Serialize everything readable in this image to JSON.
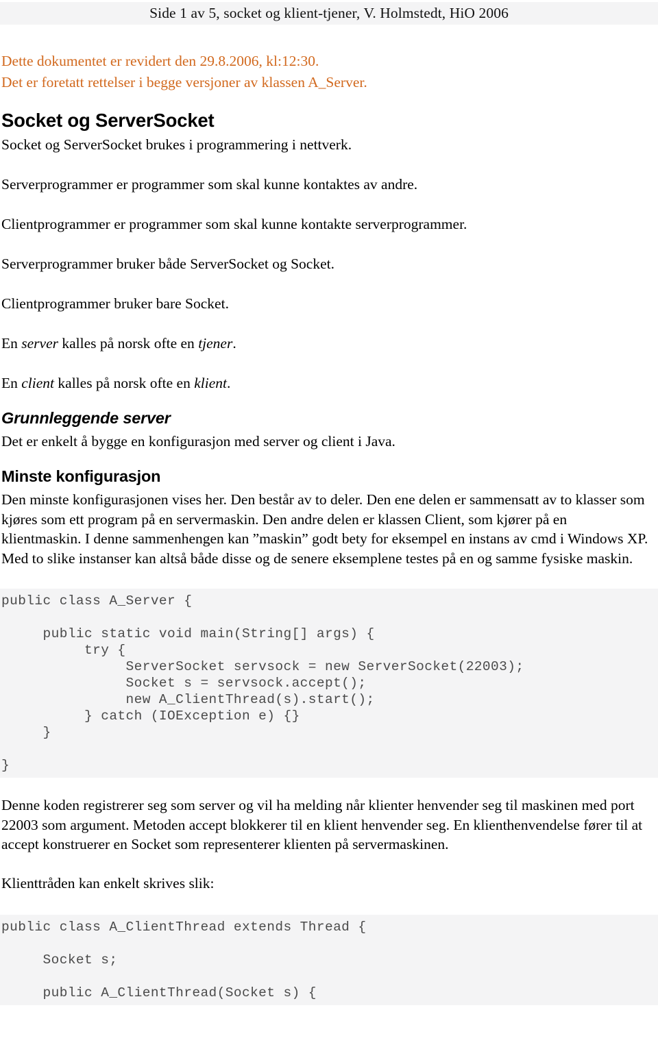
{
  "header": {
    "running_head": "Side 1 av 5, socket og klient-tjener, V. Holmstedt, HiO 2006"
  },
  "revision": {
    "line1": "Dette dokumentet er revidert den 29.8.2006, kl:12:30.",
    "line2": "Det er foretatt rettelser i begge versjoner av klassen A_Server.",
    "color": "#d2691e"
  },
  "sections": {
    "title": "Socket og ServerSocket",
    "intro_lines": [
      "Socket og ServerSocket brukes i programmering i nettverk.",
      "Serverprogrammer er programmer som skal kunne kontaktes av andre.",
      "Clientprogrammer er programmer som skal kunne kontakte serverprogrammer.",
      "Serverprogrammer bruker både ServerSocket og Socket.",
      "Clientprogrammer bruker bare Socket."
    ],
    "server_line_pre": "En ",
    "server_line_em1": "server",
    "server_line_mid": " kalles på norsk ofte en ",
    "server_line_em2": "tjener",
    "server_line_post": ".",
    "client_line_pre": "En ",
    "client_line_em1": "client",
    "client_line_mid": " kalles på norsk ofte en ",
    "client_line_em2": "klient",
    "client_line_post": ".",
    "heading_grunnleggende": "Grunnleggende server",
    "grunnleggende_body": "Det er enkelt å bygge en konfigurasjon med server og client i Java.",
    "heading_minste": "Minste konfigurasjon",
    "minste_body": "Den minste konfigurasjonen vises her. Den består av to deler. Den ene delen er sammensatt av to klasser som kjøres som ett program på en servermaskin. Den andre delen er klassen Client, som kjører på en klientmaskin. I denne sammenhengen kan ”maskin” godt bety for eksempel en instans av cmd i Windows XP. Med to slike instanser kan altså både disse og de senere eksemplene testes på en og samme fysiske maskin.",
    "after_code_body": "Denne koden registrerer seg som server og vil ha melding når klienter henvender seg til maskinen med port 22003 som argument. Metoden accept blokkerer til en klient henvender seg. En klienthenvendelse fører til at accept konstruerer en Socket som representerer klienten på servermaskinen.",
    "klienttraden_line": "Klienttråden kan enkelt skrives slik:"
  },
  "code": {
    "block1": "public class A_Server {\n\n     public static void main(String[] args) {\n          try {\n               ServerSocket servsock = new ServerSocket(22003);\n               Socket s = servsock.accept();\n               new A_ClientThread(s).start();\n          } catch (IOException e) {}\n     }\n\n}",
    "block2": "public class A_ClientThread extends Thread {\n\n     Socket s;\n\n     public A_ClientThread(Socket s) {",
    "background": "#f4f4f5",
    "text_color": "#4a4a4a"
  }
}
